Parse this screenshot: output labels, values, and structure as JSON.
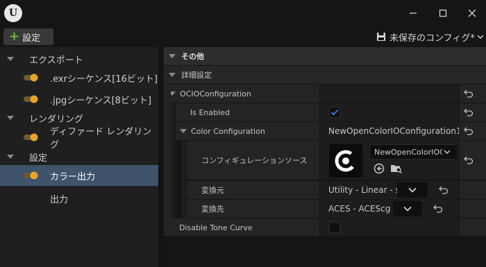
{
  "window": {
    "logo_letter": "U",
    "controls": [
      "minimize-icon",
      "maximize-icon",
      "close-icon"
    ]
  },
  "toolbar": {
    "settings_label": "設定",
    "config_label": "未保存のコンフィグ*"
  },
  "sidebar": {
    "items": [
      {
        "label": "エクスポート",
        "type": "category"
      },
      {
        "label": ".exrシーケンス[16ビット]",
        "type": "item",
        "toggle": "on"
      },
      {
        "label": ".jpgシーケンス[8ビット]",
        "type": "item",
        "toggle": "on"
      },
      {
        "label": "レンダリング",
        "type": "category"
      },
      {
        "label": "ディファード レンダリング",
        "type": "item",
        "toggle": "on"
      },
      {
        "label": "設定",
        "type": "category"
      },
      {
        "label": "カラー出力",
        "type": "item",
        "toggle": "on",
        "selected": true
      },
      {
        "label": "出力",
        "type": "item"
      }
    ]
  },
  "details": {
    "section_other": "その他",
    "section_advanced": "詳細設定",
    "ocio_configuration": "OCIOConfiguration",
    "is_enabled_label": "Is Enabled",
    "is_enabled_value": true,
    "color_configuration_label": "Color Configuration",
    "color_configuration_value": "NewOpenColorIOConfiguration1",
    "config_source_label": "コンフィギュレーションソース",
    "config_source_value": "NewOpenColorIOC",
    "source_label": "変換元",
    "source_value": "Utility - Linear - sRGB",
    "dest_label": "変換先",
    "dest_value": "ACES - ACEScg",
    "disable_tone_curve_label": "Disable Tone Curve",
    "disable_tone_curve_value": false
  },
  "colors": {
    "accent_orange": "#e8a42a",
    "selection_blue": "#3f536b",
    "checkbox_blue": "#1e6fc7",
    "add_green": "#6dbb3a"
  }
}
